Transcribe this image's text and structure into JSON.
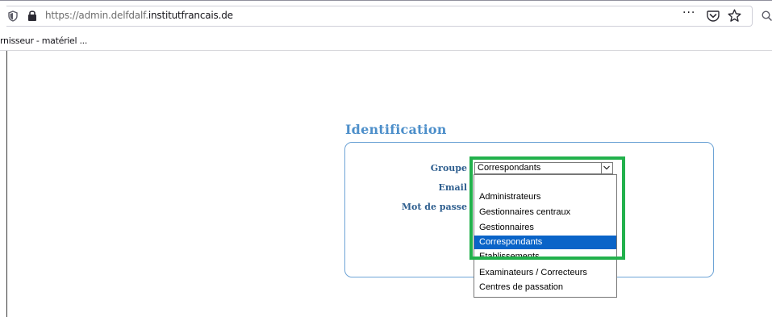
{
  "browser": {
    "url_protocol": "https://",
    "url_host_prefix": "admin.delfdalf.",
    "url_host_domain": "institutfrancais.de",
    "page_actions_label": "···",
    "bookmark_label": "rnisseur - matériel ..."
  },
  "page": {
    "title": "Identification",
    "fields": {
      "group_label": "Groupe",
      "email_label": "Email",
      "password_label": "Mot de passe"
    },
    "group_select": {
      "selected": "Correspondants",
      "options": [
        "",
        "Administrateurs",
        "Gestionnaires centraux",
        "Gestionnaires",
        "Correspondants",
        "Etablissements",
        "Examinateurs / Correcteurs",
        "Centres de passation"
      ],
      "highlighted_index": 4
    }
  },
  "colors": {
    "title": "#4d8fca",
    "label": "#2f5f8f",
    "panel_border": "#6ea4d6",
    "option_highlight": "#0a64c8",
    "annotation_box": "#22b14c"
  }
}
